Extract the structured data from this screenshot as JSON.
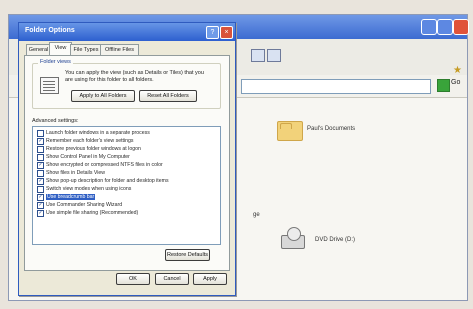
{
  "explorer": {
    "address_go_label": "Go",
    "files": [
      {
        "label": "Paul's Documents"
      },
      {
        "label": "DVD Drive (D:)"
      }
    ],
    "stray_text": "ge"
  },
  "dialog": {
    "title": "Folder Options",
    "tabs": [
      "General",
      "View",
      "File Types",
      "Offline Files"
    ],
    "active_tab": "View",
    "folder_views": {
      "group_label": "Folder views",
      "description": "You can apply the view (such as Details or Tiles) that you are using for this folder to all folders.",
      "apply_button": "Apply to All Folders",
      "reset_button": "Reset All Folders"
    },
    "advanced": {
      "label": "Advanced settings:",
      "items": [
        {
          "label": "Launch folder windows in a separate process",
          "checked": false,
          "selected": false
        },
        {
          "label": "Remember each folder's view settings",
          "checked": true,
          "selected": false
        },
        {
          "label": "Restore previous folder windows at logon",
          "checked": false,
          "selected": false
        },
        {
          "label": "Show Control Panel in My Computer",
          "checked": false,
          "selected": false
        },
        {
          "label": "Show encrypted or compressed NTFS files in color",
          "checked": true,
          "selected": false
        },
        {
          "label": "Show files in Details View",
          "checked": false,
          "selected": false
        },
        {
          "label": "Show pop-up description for folder and desktop items",
          "checked": true,
          "selected": false
        },
        {
          "label": "Switch view modes when using icons",
          "checked": false,
          "selected": false
        },
        {
          "label": "Use breadcrumb bar",
          "checked": true,
          "selected": true
        },
        {
          "label": "Use Commander Sharing Wizard",
          "checked": true,
          "selected": false
        },
        {
          "label": "Use simple file sharing (Recommended)",
          "checked": true,
          "selected": false
        }
      ],
      "restore_defaults": "Restore Defaults"
    },
    "buttons": {
      "ok": "OK",
      "cancel": "Cancel",
      "apply": "Apply"
    }
  },
  "colors": {
    "title_blue": "#2d5fcf",
    "selection_blue": "#2f5fc4",
    "dialog_face": "#ece9d8"
  },
  "icons": {
    "help": "question-icon",
    "close": "close-icon",
    "folder": "folder-icon",
    "drive": "dvd-drive-icon"
  }
}
